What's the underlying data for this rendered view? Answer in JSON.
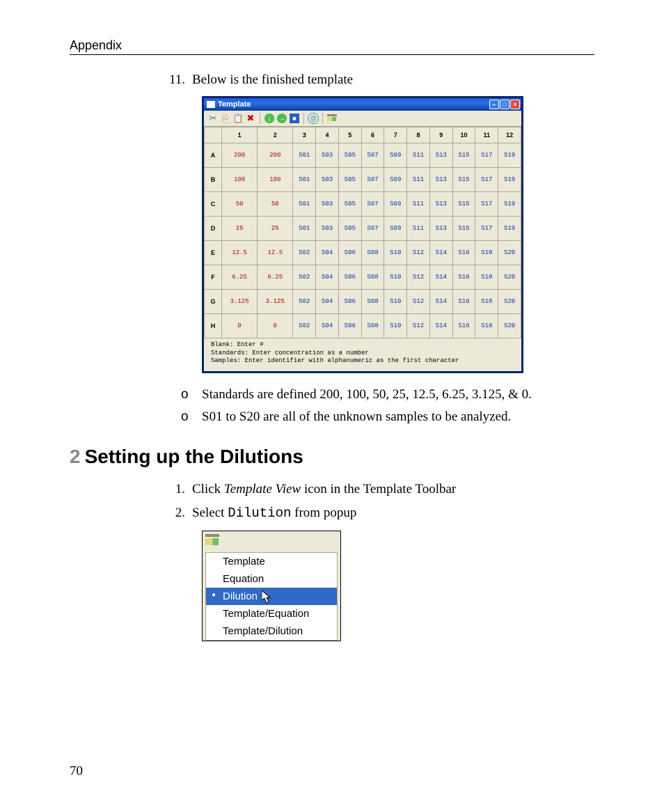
{
  "header": "Appendix",
  "page_number": "70",
  "item11": {
    "num": "11.",
    "text": "Below is the finished template"
  },
  "template_window": {
    "title": "Template",
    "columns": [
      "1",
      "2",
      "3",
      "4",
      "5",
      "6",
      "7",
      "8",
      "9",
      "10",
      "11",
      "12"
    ],
    "rows": [
      "A",
      "B",
      "C",
      "D",
      "E",
      "F",
      "G",
      "H"
    ],
    "grid": [
      [
        {
          "v": "200",
          "t": "std"
        },
        {
          "v": "200",
          "t": "std"
        },
        {
          "v": "S01",
          "t": "s"
        },
        {
          "v": "S03",
          "t": "s"
        },
        {
          "v": "S05",
          "t": "s"
        },
        {
          "v": "S07",
          "t": "s"
        },
        {
          "v": "S09",
          "t": "s"
        },
        {
          "v": "S11",
          "t": "s"
        },
        {
          "v": "S13",
          "t": "s"
        },
        {
          "v": "S15",
          "t": "s"
        },
        {
          "v": "S17",
          "t": "s"
        },
        {
          "v": "S19",
          "t": "s"
        }
      ],
      [
        {
          "v": "100",
          "t": "std"
        },
        {
          "v": "100",
          "t": "std"
        },
        {
          "v": "S01",
          "t": "s"
        },
        {
          "v": "S03",
          "t": "s"
        },
        {
          "v": "S05",
          "t": "s"
        },
        {
          "v": "S07",
          "t": "s"
        },
        {
          "v": "S09",
          "t": "s"
        },
        {
          "v": "S11",
          "t": "s"
        },
        {
          "v": "S13",
          "t": "s"
        },
        {
          "v": "S15",
          "t": "s"
        },
        {
          "v": "S17",
          "t": "s"
        },
        {
          "v": "S19",
          "t": "s"
        }
      ],
      [
        {
          "v": "50",
          "t": "std"
        },
        {
          "v": "50",
          "t": "std"
        },
        {
          "v": "S01",
          "t": "s"
        },
        {
          "v": "S03",
          "t": "s"
        },
        {
          "v": "S05",
          "t": "s"
        },
        {
          "v": "S07",
          "t": "s"
        },
        {
          "v": "S09",
          "t": "s"
        },
        {
          "v": "S11",
          "t": "s"
        },
        {
          "v": "S13",
          "t": "s"
        },
        {
          "v": "S15",
          "t": "s"
        },
        {
          "v": "S17",
          "t": "s"
        },
        {
          "v": "S19",
          "t": "s"
        }
      ],
      [
        {
          "v": "25",
          "t": "std"
        },
        {
          "v": "25",
          "t": "std"
        },
        {
          "v": "S01",
          "t": "s"
        },
        {
          "v": "S03",
          "t": "s"
        },
        {
          "v": "S05",
          "t": "s"
        },
        {
          "v": "S07",
          "t": "s"
        },
        {
          "v": "S09",
          "t": "s"
        },
        {
          "v": "S11",
          "t": "s"
        },
        {
          "v": "S13",
          "t": "s"
        },
        {
          "v": "S15",
          "t": "s"
        },
        {
          "v": "S17",
          "t": "s"
        },
        {
          "v": "S19",
          "t": "s"
        }
      ],
      [
        {
          "v": "12.5",
          "t": "std"
        },
        {
          "v": "12.5",
          "t": "std"
        },
        {
          "v": "S02",
          "t": "s"
        },
        {
          "v": "S04",
          "t": "s"
        },
        {
          "v": "S06",
          "t": "s"
        },
        {
          "v": "S08",
          "t": "s"
        },
        {
          "v": "S10",
          "t": "s"
        },
        {
          "v": "S12",
          "t": "s"
        },
        {
          "v": "S14",
          "t": "s"
        },
        {
          "v": "S16",
          "t": "s"
        },
        {
          "v": "S18",
          "t": "s"
        },
        {
          "v": "S20",
          "t": "s"
        }
      ],
      [
        {
          "v": "6.25",
          "t": "std"
        },
        {
          "v": "6.25",
          "t": "std"
        },
        {
          "v": "S02",
          "t": "s"
        },
        {
          "v": "S04",
          "t": "s"
        },
        {
          "v": "S06",
          "t": "s"
        },
        {
          "v": "S08",
          "t": "s"
        },
        {
          "v": "S10",
          "t": "s"
        },
        {
          "v": "S12",
          "t": "s"
        },
        {
          "v": "S14",
          "t": "s"
        },
        {
          "v": "S16",
          "t": "s"
        },
        {
          "v": "S18",
          "t": "s"
        },
        {
          "v": "S20",
          "t": "s"
        }
      ],
      [
        {
          "v": "3.125",
          "t": "std"
        },
        {
          "v": "3.125",
          "t": "std"
        },
        {
          "v": "S02",
          "t": "s"
        },
        {
          "v": "S04",
          "t": "s"
        },
        {
          "v": "S06",
          "t": "s"
        },
        {
          "v": "S08",
          "t": "s"
        },
        {
          "v": "S10",
          "t": "s"
        },
        {
          "v": "S12",
          "t": "s"
        },
        {
          "v": "S14",
          "t": "s"
        },
        {
          "v": "S16",
          "t": "s"
        },
        {
          "v": "S18",
          "t": "s"
        },
        {
          "v": "S20",
          "t": "s"
        }
      ],
      [
        {
          "v": "0",
          "t": "std"
        },
        {
          "v": "0",
          "t": "std"
        },
        {
          "v": "S02",
          "t": "s"
        },
        {
          "v": "S04",
          "t": "s"
        },
        {
          "v": "S06",
          "t": "s"
        },
        {
          "v": "S08",
          "t": "s"
        },
        {
          "v": "S10",
          "t": "s"
        },
        {
          "v": "S12",
          "t": "s"
        },
        {
          "v": "S14",
          "t": "s"
        },
        {
          "v": "S16",
          "t": "s"
        },
        {
          "v": "S18",
          "t": "s"
        },
        {
          "v": "S20",
          "t": "s"
        }
      ]
    ],
    "footer_lines": [
      "Blank: Enter #",
      "Standards: Enter concentration as a number",
      "Samples: Enter identifier with alphanumeric as the first character"
    ]
  },
  "bullets": {
    "b1": "Standards are defined 200, 100, 50, 25, 12.5, 6.25, 3.125, & 0.",
    "b2": "S01 to S20 are all of the unknown samples to be analyzed."
  },
  "section2": {
    "num": "2",
    "title": "Setting up the Dilutions",
    "step1_num": "1.",
    "step1_a": "Click ",
    "step1_b": "Template View",
    "step1_c": " icon in the Template Toolbar",
    "step2_num": "2.",
    "step2_a": "Select ",
    "step2_b": "Dilution",
    "step2_c": " from popup"
  },
  "popup_menu": {
    "items": [
      "Template",
      "Equation",
      "Dilution",
      "Template/Equation",
      "Template/Dilution"
    ],
    "selected_index": 2
  }
}
